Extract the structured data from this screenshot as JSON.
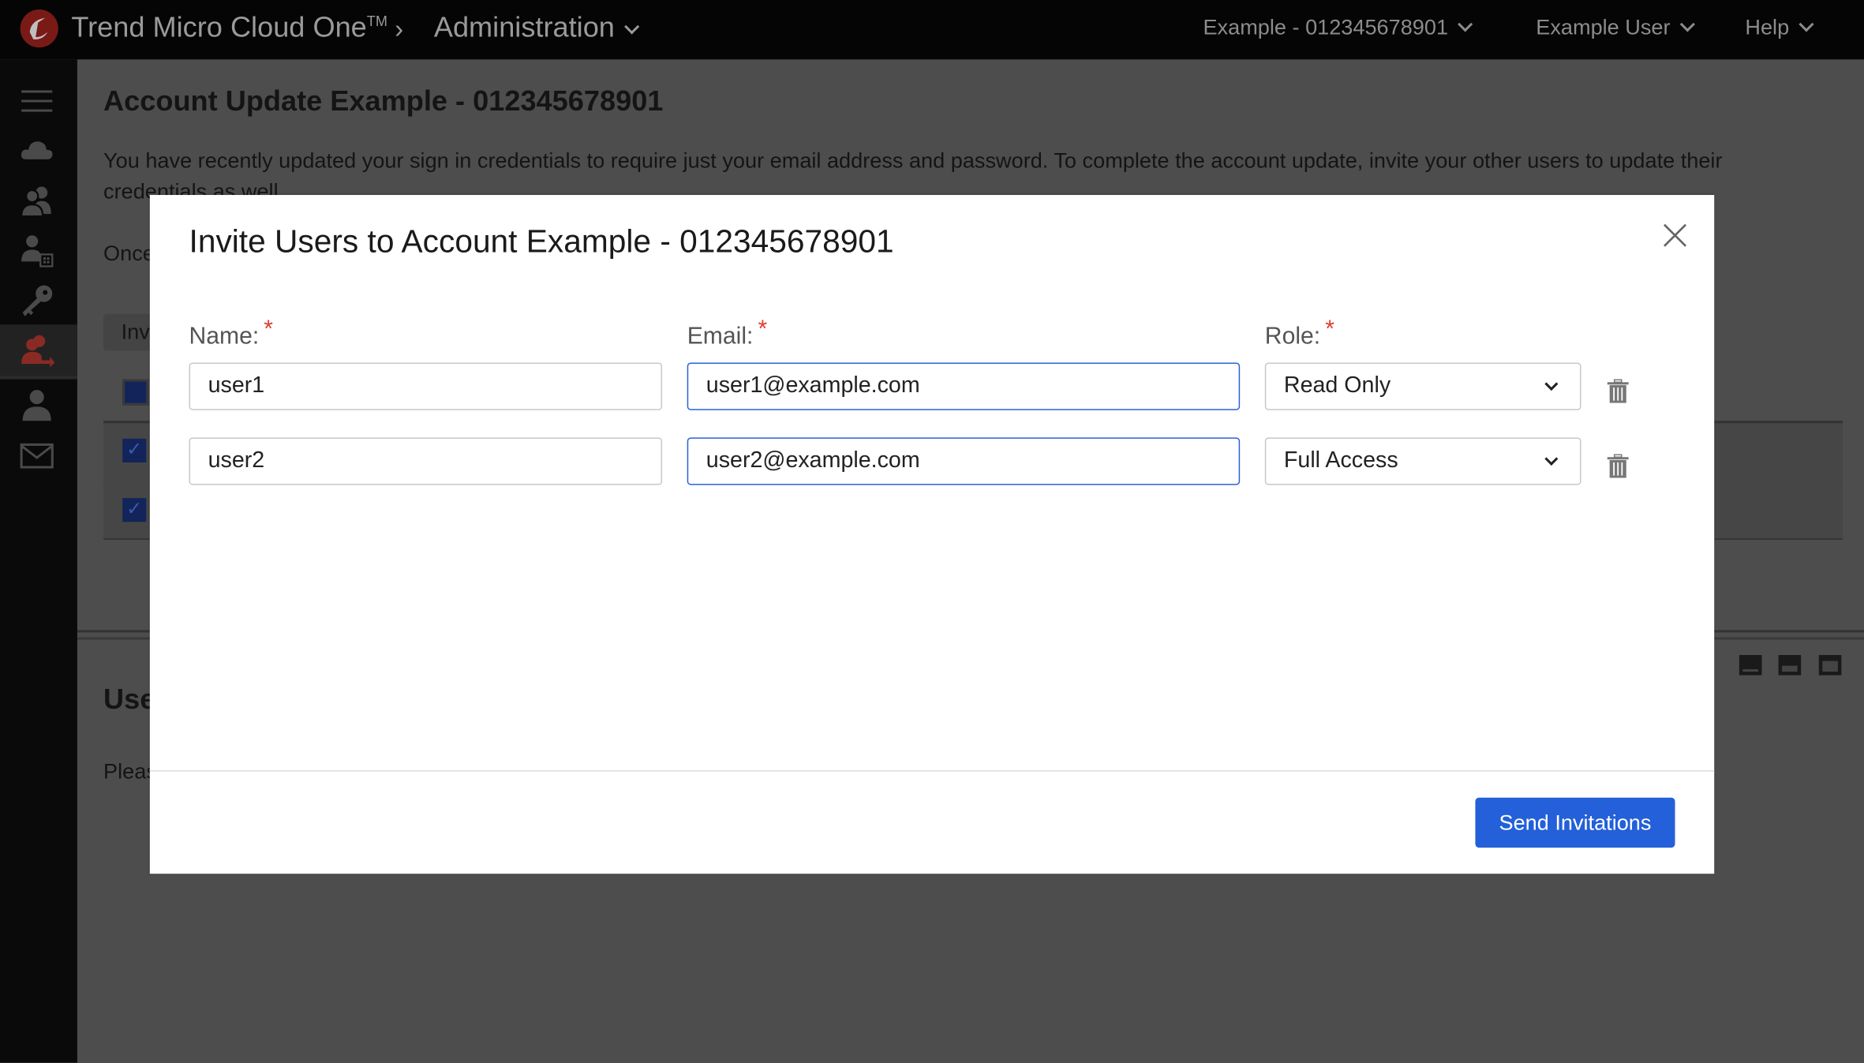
{
  "topbar": {
    "product": "Trend Micro Cloud One",
    "trademark": "TM",
    "section": "Administration",
    "account": "Example - 012345678901",
    "user": "Example User",
    "help": "Help"
  },
  "sidebar": {
    "items": [
      "menu-icon",
      "cloud-icon",
      "users-icon",
      "user-roles-icon",
      "key-icon",
      "invite-users-icon",
      "user-icon",
      "mail-icon"
    ],
    "active": "invite-users-icon",
    "active_color": "#c0392b"
  },
  "main": {
    "title": "Account Update Example - 012345678901",
    "paragraph_line1": "You have recently updated your sign in credentials to require just your email address and password. To complete the account update, invite your other users to update their",
    "paragraph_line2": "credentials as well.",
    "once_text": "Once",
    "invite_button": "Inv",
    "users_heading": "Use",
    "please_text": "Pleas"
  },
  "modal": {
    "title": "Invite Users to Account Example - 012345678901",
    "labels": {
      "name": "Name:",
      "email": "Email:",
      "role": "Role:",
      "required": "*"
    },
    "rows": [
      {
        "name": "user1",
        "email": "user1@example.com",
        "role": "Read Only"
      },
      {
        "name": "user2",
        "email": "user2@example.com",
        "role": "Full Access"
      }
    ],
    "send_button": "Send Invitations",
    "accent": "#2360d9"
  }
}
